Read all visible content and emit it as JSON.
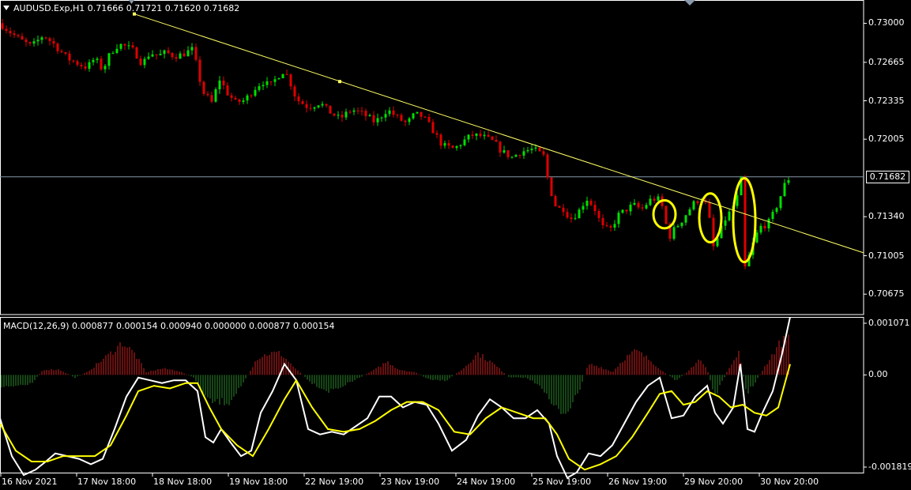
{
  "header": {
    "symbol": "AUDUSD.Exp,H1",
    "open": "0.71666",
    "high": "0.71721",
    "low": "0.71620",
    "close": "0.71682"
  },
  "price_tag": "0.71682",
  "macd_header": {
    "name": "MACD(12,26,9)",
    "values": [
      "0.000877",
      "0.000154",
      "0.000940",
      "0.000000",
      "0.000877",
      "0.000154"
    ]
  },
  "colors": {
    "background": "#000000",
    "bull": "#00e000",
    "bear": "#e00000",
    "trendline": "#ffff66",
    "ellipse": "#ffff00",
    "macd_line": "#ffffff",
    "signal_line": "#ffff00",
    "hist_pos": "#cc2020",
    "hist_neg": "#2c8a2c",
    "price_line": "#8899aa",
    "border": "#ffffff"
  },
  "chart_data": [
    {
      "type": "candlestick",
      "title": "",
      "y_ticks": [
        "0.73000",
        "0.72665",
        "0.72335",
        "0.72005",
        "0.71340",
        "0.71005",
        "0.70675"
      ],
      "ylim": [
        0.705,
        0.732
      ],
      "current_price": 0.71682,
      "x_ticks": [
        "16 Nov 2021",
        "17 Nov 18:00",
        "18 Nov 18:00",
        "19 Nov 18:00",
        "22 Nov 19:00",
        "23 Nov 19:00",
        "24 Nov 19:00",
        "25 Nov 19:00",
        "26 Nov 19:00",
        "29 Nov 20:00",
        "30 Nov 20:00"
      ],
      "close_path": [
        [
          0,
          0.73
        ],
        [
          10,
          0.7294
        ],
        [
          25,
          0.7286
        ],
        [
          40,
          0.728
        ],
        [
          55,
          0.729
        ],
        [
          70,
          0.7281
        ],
        [
          85,
          0.727
        ],
        [
          100,
          0.7265
        ],
        [
          110,
          0.7262
        ],
        [
          120,
          0.727
        ],
        [
          130,
          0.726
        ],
        [
          140,
          0.7275
        ],
        [
          150,
          0.7282
        ],
        [
          160,
          0.728
        ],
        [
          170,
          0.7276
        ],
        [
          180,
          0.7265
        ],
        [
          190,
          0.7275
        ],
        [
          200,
          0.7272
        ],
        [
          210,
          0.7275
        ],
        [
          220,
          0.7272
        ],
        [
          230,
          0.7273
        ],
        [
          245,
          0.7278
        ],
        [
          250,
          0.7258
        ],
        [
          258,
          0.724
        ],
        [
          268,
          0.7232
        ],
        [
          278,
          0.7252
        ],
        [
          288,
          0.724
        ],
        [
          298,
          0.7232
        ],
        [
          310,
          0.7234
        ],
        [
          322,
          0.7244
        ],
        [
          332,
          0.725
        ],
        [
          342,
          0.7246
        ],
        [
          352,
          0.7255
        ],
        [
          360,
          0.726
        ],
        [
          368,
          0.7248
        ],
        [
          375,
          0.7235
        ],
        [
          390,
          0.7228
        ],
        [
          405,
          0.7232
        ],
        [
          415,
          0.7225
        ],
        [
          430,
          0.7218
        ],
        [
          445,
          0.7226
        ],
        [
          460,
          0.7222
        ],
        [
          475,
          0.7215
        ],
        [
          490,
          0.7226
        ],
        [
          505,
          0.7218
        ],
        [
          515,
          0.7214
        ],
        [
          525,
          0.7222
        ],
        [
          535,
          0.722
        ],
        [
          548,
          0.7208
        ],
        [
          560,
          0.7195
        ],
        [
          575,
          0.7192
        ],
        [
          585,
          0.7198
        ],
        [
          597,
          0.7204
        ],
        [
          610,
          0.7203
        ],
        [
          625,
          0.7198
        ],
        [
          635,
          0.719
        ],
        [
          648,
          0.7185
        ],
        [
          660,
          0.719
        ],
        [
          675,
          0.7192
        ],
        [
          688,
          0.7186
        ],
        [
          695,
          0.716
        ],
        [
          705,
          0.714
        ],
        [
          712,
          0.7142
        ],
        [
          722,
          0.7132
        ],
        [
          732,
          0.7138
        ],
        [
          742,
          0.715
        ],
        [
          752,
          0.7142
        ],
        [
          762,
          0.7125
        ],
        [
          772,
          0.7122
        ],
        [
          782,
          0.7135
        ],
        [
          792,
          0.714
        ],
        [
          802,
          0.7144
        ],
        [
          812,
          0.714
        ],
        [
          822,
          0.7148
        ],
        [
          832,
          0.715
        ],
        [
          840,
          0.714
        ],
        [
          846,
          0.7115
        ],
        [
          852,
          0.7122
        ],
        [
          862,
          0.713
        ],
        [
          872,
          0.714
        ],
        [
          880,
          0.7147
        ],
        [
          890,
          0.715
        ],
        [
          896,
          0.714
        ],
        [
          903,
          0.7108
        ],
        [
          910,
          0.7118
        ],
        [
          918,
          0.7132
        ],
        [
          926,
          0.714
        ],
        [
          934,
          0.7152
        ],
        [
          938,
          0.7165
        ],
        [
          943,
          0.709
        ],
        [
          948,
          0.71
        ],
        [
          955,
          0.7115
        ],
        [
          962,
          0.7125
        ],
        [
          972,
          0.7128
        ],
        [
          980,
          0.7138
        ],
        [
          988,
          0.7152
        ],
        [
          995,
          0.7165
        ],
        [
          1001,
          0.7168
        ]
      ],
      "trendline": [
        [
          170,
          0.7308
        ],
        [
          1093,
          0.7103
        ]
      ],
      "trendline_handles": [
        [
          170,
          0.7308
        ],
        [
          430,
          0.725
        ]
      ],
      "ellipses": [
        {
          "x_center": 841,
          "y_center": 0.7136,
          "x_radius": 14,
          "y_radius": 0.0012
        },
        {
          "x_center": 899,
          "y_center": 0.7133,
          "x_radius": 14,
          "y_radius": 0.0021
        },
        {
          "x_center": 942,
          "y_center": 0.7131,
          "x_radius": 14,
          "y_radius": 0.0036
        }
      ]
    },
    {
      "type": "macd",
      "title": "",
      "y_ticks": [
        "0.001071",
        "0.00",
        "-0.001819"
      ],
      "ylim": [
        -0.001819,
        0.001071
      ],
      "histogram_profile": [
        [
          0,
          -0.00025
        ],
        [
          40,
          -0.00015
        ],
        [
          55,
          0.0001
        ],
        [
          75,
          0.0001
        ],
        [
          95,
          -5e-05
        ],
        [
          110,
          5e-05
        ],
        [
          140,
          0.0004
        ],
        [
          155,
          0.0006
        ],
        [
          170,
          0.0004
        ],
        [
          185,
          5e-05
        ],
        [
          205,
          0.00012
        ],
        [
          225,
          8e-05
        ],
        [
          245,
          -5e-05
        ],
        [
          265,
          -0.0005
        ],
        [
          290,
          -0.0005
        ],
        [
          310,
          -0.0001
        ],
        [
          325,
          0.0003
        ],
        [
          340,
          0.0004
        ],
        [
          355,
          0.0004
        ],
        [
          375,
          0.0001
        ],
        [
          395,
          -0.00015
        ],
        [
          415,
          -0.0003
        ],
        [
          435,
          -0.0002
        ],
        [
          455,
          -5e-05
        ],
        [
          475,
          0.0001
        ],
        [
          490,
          0.00025
        ],
        [
          505,
          0.0001
        ],
        [
          525,
          5e-05
        ],
        [
          545,
          -0.0001
        ],
        [
          565,
          -0.0001
        ],
        [
          585,
          0.0001
        ],
        [
          605,
          0.0004
        ],
        [
          625,
          0.0002
        ],
        [
          645,
          -5e-05
        ],
        [
          665,
          -5e-05
        ],
        [
          685,
          -0.0002
        ],
        [
          700,
          -0.0006
        ],
        [
          715,
          -0.0007
        ],
        [
          730,
          -0.0004
        ],
        [
          745,
          0.0002
        ],
        [
          760,
          0.00015
        ],
        [
          775,
          5e-05
        ],
        [
          790,
          0.0003
        ],
        [
          805,
          0.00045
        ],
        [
          825,
          0.00025
        ],
        [
          840,
          5e-05
        ],
        [
          855,
          -0.0001
        ],
        [
          870,
          5e-05
        ],
        [
          885,
          0.0003
        ],
        [
          895,
          0.0001
        ],
        [
          905,
          -0.0004
        ],
        [
          915,
          -0.0001
        ],
        [
          925,
          0.0002
        ],
        [
          935,
          0.00045
        ],
        [
          945,
          -0.00035
        ],
        [
          955,
          -0.00015
        ],
        [
          970,
          0.0002
        ],
        [
          985,
          0.00055
        ],
        [
          1000,
          0.00075
        ]
      ],
      "macd_line": [
        [
          0,
          -0.0008
        ],
        [
          15,
          -0.0015
        ],
        [
          30,
          -0.00185
        ],
        [
          45,
          -0.00175
        ],
        [
          58,
          -0.0016
        ],
        [
          70,
          -0.00145
        ],
        [
          85,
          -0.0015
        ],
        [
          100,
          -0.00155
        ],
        [
          115,
          -0.00165
        ],
        [
          130,
          -0.00155
        ],
        [
          145,
          -0.001
        ],
        [
          160,
          -0.0004
        ],
        [
          175,
          -5e-05
        ],
        [
          190,
          -0.0001
        ],
        [
          205,
          -0.00015
        ],
        [
          220,
          -0.0001
        ],
        [
          235,
          -0.0001
        ],
        [
          250,
          -0.0003
        ],
        [
          260,
          -0.00115
        ],
        [
          270,
          -0.00125
        ],
        [
          280,
          -0.001
        ],
        [
          292,
          -0.00125
        ],
        [
          305,
          -0.0015
        ],
        [
          318,
          -0.0014
        ],
        [
          330,
          -0.0007
        ],
        [
          345,
          -0.0003
        ],
        [
          360,
          0.0002
        ],
        [
          375,
          -0.0001
        ],
        [
          390,
          -0.001
        ],
        [
          405,
          -0.0011
        ],
        [
          420,
          -0.00105
        ],
        [
          435,
          -0.0011
        ],
        [
          450,
          -0.00095
        ],
        [
          465,
          -0.0008
        ],
        [
          480,
          -0.0004
        ],
        [
          495,
          -0.0004
        ],
        [
          510,
          -0.0006
        ],
        [
          525,
          -0.0005
        ],
        [
          540,
          -0.00055
        ],
        [
          555,
          -0.0009
        ],
        [
          572,
          -0.0014
        ],
        [
          590,
          -0.0012
        ],
        [
          605,
          -0.00075
        ],
        [
          620,
          -0.00045
        ],
        [
          635,
          -0.0006
        ],
        [
          650,
          -0.0008
        ],
        [
          665,
          -0.0008
        ],
        [
          680,
          -0.00065
        ],
        [
          695,
          -0.0009
        ],
        [
          705,
          -0.0015
        ],
        [
          718,
          -0.0019
        ],
        [
          730,
          -0.0018
        ],
        [
          745,
          -0.00145
        ],
        [
          760,
          -0.0015
        ],
        [
          775,
          -0.0013
        ],
        [
          790,
          -0.0009
        ],
        [
          805,
          -0.0005
        ],
        [
          820,
          -0.0002
        ],
        [
          835,
          -5e-05
        ],
        [
          850,
          -0.0008
        ],
        [
          865,
          -0.00075
        ],
        [
          880,
          -0.0004
        ],
        [
          895,
          -0.0002
        ],
        [
          905,
          -0.0007
        ],
        [
          915,
          -0.0009
        ],
        [
          928,
          -0.0006
        ],
        [
          937,
          0.0002
        ],
        [
          946,
          -0.001
        ],
        [
          955,
          -0.00105
        ],
        [
          965,
          -0.0007
        ],
        [
          978,
          -0.0003
        ],
        [
          990,
          0.0004
        ],
        [
          1000,
          0.00107
        ]
      ],
      "signal_line": [
        [
          0,
          -0.0009
        ],
        [
          20,
          -0.0014
        ],
        [
          40,
          -0.0016
        ],
        [
          60,
          -0.0016
        ],
        [
          80,
          -0.0015
        ],
        [
          100,
          -0.0015
        ],
        [
          120,
          -0.0015
        ],
        [
          140,
          -0.0013
        ],
        [
          160,
          -0.00075
        ],
        [
          175,
          -0.0003
        ],
        [
          195,
          -0.0002
        ],
        [
          215,
          -0.00025
        ],
        [
          235,
          -0.00015
        ],
        [
          250,
          -0.00015
        ],
        [
          265,
          -0.0006
        ],
        [
          280,
          -0.001
        ],
        [
          300,
          -0.0013
        ],
        [
          320,
          -0.0015
        ],
        [
          340,
          -0.001
        ],
        [
          360,
          -0.00045
        ],
        [
          375,
          -0.0001
        ],
        [
          395,
          -0.0006
        ],
        [
          415,
          -0.001
        ],
        [
          435,
          -0.00105
        ],
        [
          455,
          -0.001
        ],
        [
          475,
          -0.00085
        ],
        [
          495,
          -0.00065
        ],
        [
          515,
          -0.0005
        ],
        [
          535,
          -0.0005
        ],
        [
          555,
          -0.00065
        ],
        [
          575,
          -0.00105
        ],
        [
          595,
          -0.0011
        ],
        [
          615,
          -0.0008
        ],
        [
          635,
          -0.0006
        ],
        [
          655,
          -0.0007
        ],
        [
          675,
          -0.0008
        ],
        [
          690,
          -0.0008
        ],
        [
          705,
          -0.0011
        ],
        [
          720,
          -0.00155
        ],
        [
          740,
          -0.00175
        ],
        [
          760,
          -0.00165
        ],
        [
          780,
          -0.0015
        ],
        [
          800,
          -0.00115
        ],
        [
          820,
          -0.0007
        ],
        [
          835,
          -0.00035
        ],
        [
          850,
          -0.0003
        ],
        [
          865,
          -0.00055
        ],
        [
          880,
          -0.0005
        ],
        [
          895,
          -0.0003
        ],
        [
          910,
          -0.0004
        ],
        [
          925,
          -0.0006
        ],
        [
          940,
          -0.00055
        ],
        [
          955,
          -0.0007
        ],
        [
          970,
          -0.00075
        ],
        [
          985,
          -0.0006
        ],
        [
          1000,
          0.0002
        ]
      ]
    }
  ]
}
